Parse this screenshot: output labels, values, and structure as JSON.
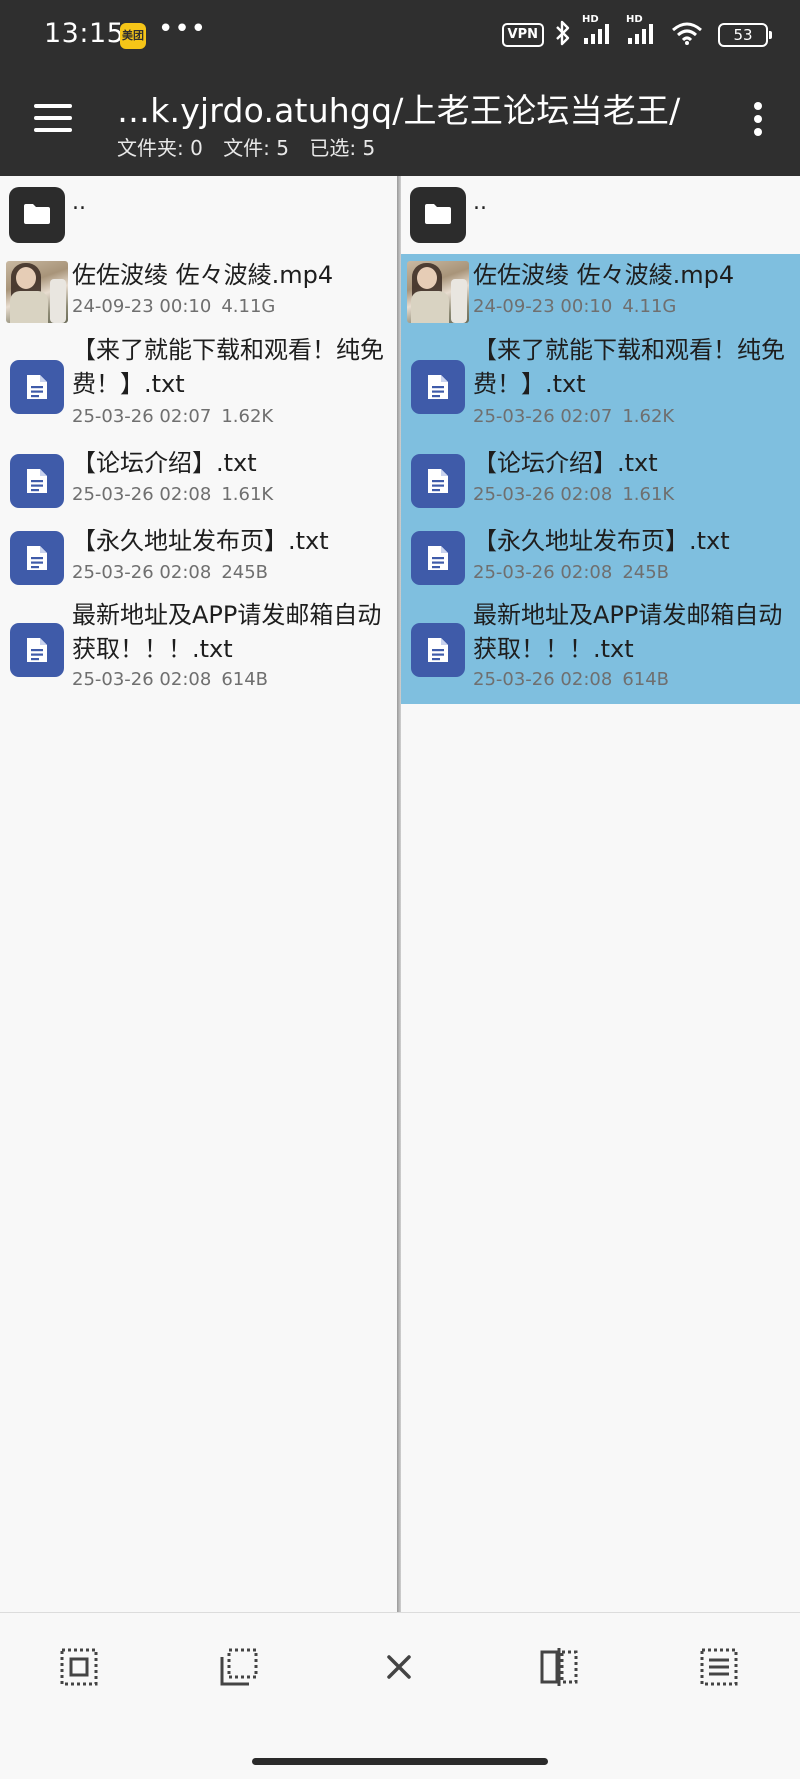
{
  "status_bar": {
    "time": "13:15",
    "app_badge": "美团",
    "more_dots": "•••",
    "vpn": "VPN",
    "battery": "53",
    "hd1": "HD",
    "hd2": "HD",
    "icons": [
      "meituan-app-icon",
      "bluetooth-icon",
      "signal-hd-icon",
      "signal-hd-icon",
      "wifi-icon",
      "battery-icon"
    ]
  },
  "toolbar": {
    "path": "…k.yjrdo.atuhgq/上老王论坛当老王/",
    "folders": "文件夹: 0",
    "files": "文件: 5",
    "selected": "已选: 5"
  },
  "parent_label": "..",
  "files": [
    {
      "name": "佐佐波绫 佐々波綾.mp4",
      "date": "24-09-23 00:10",
      "size": "4.11G",
      "type": "video"
    },
    {
      "name": "【来了就能下载和观看！纯免费！】.txt",
      "date": "25-03-26 02:07",
      "size": "1.62K",
      "type": "text"
    },
    {
      "name": "【论坛介绍】.txt",
      "date": "25-03-26 02:08",
      "size": "1.61K",
      "type": "text"
    },
    {
      "name": "【永久地址发布页】.txt",
      "date": "25-03-26 02:08",
      "size": "245B",
      "type": "text"
    },
    {
      "name": "最新地址及APP请发邮箱自动获取！！！.txt",
      "date": "25-03-26 02:08",
      "size": "614B",
      "type": "text"
    }
  ],
  "bottom_actions": [
    "select-all-icon",
    "select-partial-icon",
    "clear-selection-icon",
    "swap-panes-icon",
    "select-list-icon"
  ],
  "colors": {
    "bar_bg": "#2f2f2f",
    "selected_bg": "#7fbfdf",
    "doc_icon": "#3f5ba9"
  }
}
